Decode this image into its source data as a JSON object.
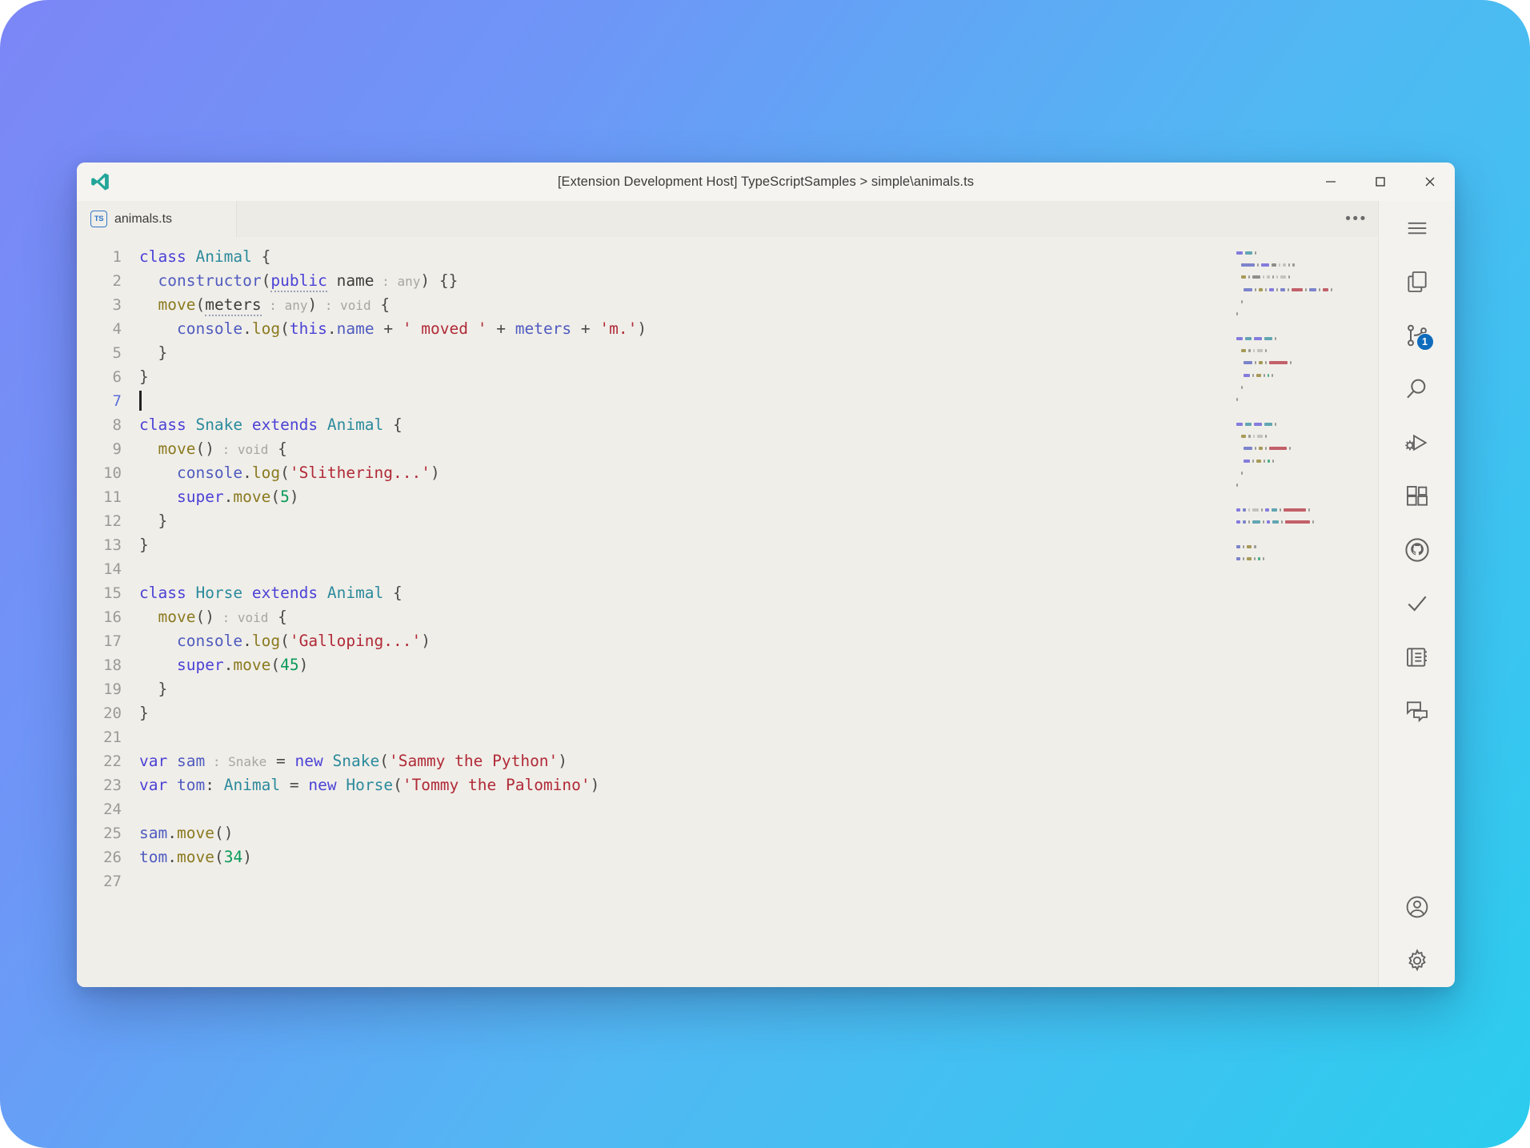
{
  "window": {
    "title": "[Extension Development Host] TypeScriptSamples > simple\\animals.ts",
    "logo_icon": "vscode-logo-icon",
    "controls": {
      "minimize": "minimize-icon",
      "maximize": "maximize-icon",
      "close": "close-icon"
    }
  },
  "tabbar": {
    "tabs": [
      {
        "label": "animals.ts",
        "icon": "typescript-file-icon",
        "badge_text": "TS",
        "active": true
      }
    ],
    "more_actions": "•••"
  },
  "editor": {
    "language": "typescript",
    "cursor_line": 7,
    "background_color": "#f0eee9",
    "total_lines": 27,
    "lines": [
      {
        "n": 1,
        "tokens": [
          {
            "t": "class",
            "c": "t-key"
          },
          {
            "t": " ",
            "c": "t-plain"
          },
          {
            "t": "Animal",
            "c": "t-type"
          },
          {
            "t": " ",
            "c": "t-plain"
          },
          {
            "t": "{",
            "c": "t-punct"
          }
        ]
      },
      {
        "n": 2,
        "tokens": [
          {
            "t": "  ",
            "c": "t-plain"
          },
          {
            "t": "constructor",
            "c": "t-var"
          },
          {
            "t": "(",
            "c": "t-punct"
          },
          {
            "t": "public",
            "c": "t-key",
            "squiggle": true
          },
          {
            "t": " ",
            "c": "t-plain"
          },
          {
            "t": "name",
            "c": "t-plain"
          },
          {
            "t": " : ",
            "c": "t-hint"
          },
          {
            "t": "any",
            "c": "t-hint"
          },
          {
            "t": ")",
            "c": "t-punct"
          },
          {
            "t": " ",
            "c": "t-plain"
          },
          {
            "t": "{}",
            "c": "t-punct"
          }
        ]
      },
      {
        "n": 3,
        "tokens": [
          {
            "t": "  ",
            "c": "t-plain"
          },
          {
            "t": "move",
            "c": "t-fn"
          },
          {
            "t": "(",
            "c": "t-punct"
          },
          {
            "t": "meters",
            "c": "t-plain",
            "squiggle": true
          },
          {
            "t": " : ",
            "c": "t-hint"
          },
          {
            "t": "any",
            "c": "t-hint"
          },
          {
            "t": ")",
            "c": "t-punct"
          },
          {
            "t": " : ",
            "c": "t-hint"
          },
          {
            "t": "void",
            "c": "t-hint"
          },
          {
            "t": " ",
            "c": "t-plain"
          },
          {
            "t": "{",
            "c": "t-punct"
          }
        ]
      },
      {
        "n": 4,
        "tokens": [
          {
            "t": "    ",
            "c": "t-plain"
          },
          {
            "t": "console",
            "c": "t-var"
          },
          {
            "t": ".",
            "c": "t-punct"
          },
          {
            "t": "log",
            "c": "t-fn"
          },
          {
            "t": "(",
            "c": "t-punct"
          },
          {
            "t": "this",
            "c": "t-key"
          },
          {
            "t": ".",
            "c": "t-punct"
          },
          {
            "t": "name",
            "c": "t-var"
          },
          {
            "t": " + ",
            "c": "t-op"
          },
          {
            "t": "' moved '",
            "c": "t-str"
          },
          {
            "t": " + ",
            "c": "t-op"
          },
          {
            "t": "meters",
            "c": "t-var"
          },
          {
            "t": " + ",
            "c": "t-op"
          },
          {
            "t": "'m.'",
            "c": "t-str"
          },
          {
            "t": ")",
            "c": "t-punct"
          }
        ]
      },
      {
        "n": 5,
        "tokens": [
          {
            "t": "  ",
            "c": "t-plain"
          },
          {
            "t": "}",
            "c": "t-punct"
          }
        ]
      },
      {
        "n": 6,
        "tokens": [
          {
            "t": "}",
            "c": "t-punct"
          }
        ]
      },
      {
        "n": 7,
        "tokens": [],
        "cursor": true
      },
      {
        "n": 8,
        "tokens": [
          {
            "t": "class",
            "c": "t-key"
          },
          {
            "t": " ",
            "c": "t-plain"
          },
          {
            "t": "Snake",
            "c": "t-type"
          },
          {
            "t": " ",
            "c": "t-plain"
          },
          {
            "t": "extends",
            "c": "t-key"
          },
          {
            "t": " ",
            "c": "t-plain"
          },
          {
            "t": "Animal",
            "c": "t-type"
          },
          {
            "t": " ",
            "c": "t-plain"
          },
          {
            "t": "{",
            "c": "t-punct"
          }
        ]
      },
      {
        "n": 9,
        "tokens": [
          {
            "t": "  ",
            "c": "t-plain"
          },
          {
            "t": "move",
            "c": "t-fn"
          },
          {
            "t": "()",
            "c": "t-punct"
          },
          {
            "t": " : ",
            "c": "t-hint"
          },
          {
            "t": "void",
            "c": "t-hint"
          },
          {
            "t": " ",
            "c": "t-plain"
          },
          {
            "t": "{",
            "c": "t-punct"
          }
        ]
      },
      {
        "n": 10,
        "tokens": [
          {
            "t": "    ",
            "c": "t-plain"
          },
          {
            "t": "console",
            "c": "t-var"
          },
          {
            "t": ".",
            "c": "t-punct"
          },
          {
            "t": "log",
            "c": "t-fn"
          },
          {
            "t": "(",
            "c": "t-punct"
          },
          {
            "t": "'Slithering...'",
            "c": "t-str"
          },
          {
            "t": ")",
            "c": "t-punct"
          }
        ]
      },
      {
        "n": 11,
        "tokens": [
          {
            "t": "    ",
            "c": "t-plain"
          },
          {
            "t": "super",
            "c": "t-key"
          },
          {
            "t": ".",
            "c": "t-punct"
          },
          {
            "t": "move",
            "c": "t-fn"
          },
          {
            "t": "(",
            "c": "t-punct"
          },
          {
            "t": "5",
            "c": "t-num"
          },
          {
            "t": ")",
            "c": "t-punct"
          }
        ]
      },
      {
        "n": 12,
        "tokens": [
          {
            "t": "  ",
            "c": "t-plain"
          },
          {
            "t": "}",
            "c": "t-punct"
          }
        ]
      },
      {
        "n": 13,
        "tokens": [
          {
            "t": "}",
            "c": "t-punct"
          }
        ]
      },
      {
        "n": 14,
        "tokens": []
      },
      {
        "n": 15,
        "tokens": [
          {
            "t": "class",
            "c": "t-key"
          },
          {
            "t": " ",
            "c": "t-plain"
          },
          {
            "t": "Horse",
            "c": "t-type"
          },
          {
            "t": " ",
            "c": "t-plain"
          },
          {
            "t": "extends",
            "c": "t-key"
          },
          {
            "t": " ",
            "c": "t-plain"
          },
          {
            "t": "Animal",
            "c": "t-type"
          },
          {
            "t": " ",
            "c": "t-plain"
          },
          {
            "t": "{",
            "c": "t-punct"
          }
        ]
      },
      {
        "n": 16,
        "tokens": [
          {
            "t": "  ",
            "c": "t-plain"
          },
          {
            "t": "move",
            "c": "t-fn"
          },
          {
            "t": "()",
            "c": "t-punct"
          },
          {
            "t": " : ",
            "c": "t-hint"
          },
          {
            "t": "void",
            "c": "t-hint"
          },
          {
            "t": " ",
            "c": "t-plain"
          },
          {
            "t": "{",
            "c": "t-punct"
          }
        ]
      },
      {
        "n": 17,
        "tokens": [
          {
            "t": "    ",
            "c": "t-plain"
          },
          {
            "t": "console",
            "c": "t-var"
          },
          {
            "t": ".",
            "c": "t-punct"
          },
          {
            "t": "log",
            "c": "t-fn"
          },
          {
            "t": "(",
            "c": "t-punct"
          },
          {
            "t": "'Galloping...'",
            "c": "t-str"
          },
          {
            "t": ")",
            "c": "t-punct"
          }
        ]
      },
      {
        "n": 18,
        "tokens": [
          {
            "t": "    ",
            "c": "t-plain"
          },
          {
            "t": "super",
            "c": "t-key"
          },
          {
            "t": ".",
            "c": "t-punct"
          },
          {
            "t": "move",
            "c": "t-fn"
          },
          {
            "t": "(",
            "c": "t-punct"
          },
          {
            "t": "45",
            "c": "t-num"
          },
          {
            "t": ")",
            "c": "t-punct"
          }
        ]
      },
      {
        "n": 19,
        "tokens": [
          {
            "t": "  ",
            "c": "t-plain"
          },
          {
            "t": "}",
            "c": "t-punct"
          }
        ]
      },
      {
        "n": 20,
        "tokens": [
          {
            "t": "}",
            "c": "t-punct"
          }
        ]
      },
      {
        "n": 21,
        "tokens": []
      },
      {
        "n": 22,
        "tokens": [
          {
            "t": "var",
            "c": "t-key"
          },
          {
            "t": " ",
            "c": "t-plain"
          },
          {
            "t": "sam",
            "c": "t-var"
          },
          {
            "t": " : ",
            "c": "t-hint"
          },
          {
            "t": "Snake",
            "c": "t-hint"
          },
          {
            "t": " = ",
            "c": "t-op"
          },
          {
            "t": "new",
            "c": "t-key"
          },
          {
            "t": " ",
            "c": "t-plain"
          },
          {
            "t": "Snake",
            "c": "t-type"
          },
          {
            "t": "(",
            "c": "t-punct"
          },
          {
            "t": "'Sammy the Python'",
            "c": "t-str"
          },
          {
            "t": ")",
            "c": "t-punct"
          }
        ]
      },
      {
        "n": 23,
        "tokens": [
          {
            "t": "var",
            "c": "t-key"
          },
          {
            "t": " ",
            "c": "t-plain"
          },
          {
            "t": "tom",
            "c": "t-var"
          },
          {
            "t": ": ",
            "c": "t-punct"
          },
          {
            "t": "Animal",
            "c": "t-type"
          },
          {
            "t": " = ",
            "c": "t-op"
          },
          {
            "t": "new",
            "c": "t-key"
          },
          {
            "t": " ",
            "c": "t-plain"
          },
          {
            "t": "Horse",
            "c": "t-type"
          },
          {
            "t": "(",
            "c": "t-punct"
          },
          {
            "t": "'Tommy the Palomino'",
            "c": "t-str"
          },
          {
            "t": ")",
            "c": "t-punct"
          }
        ]
      },
      {
        "n": 24,
        "tokens": []
      },
      {
        "n": 25,
        "tokens": [
          {
            "t": "sam",
            "c": "t-var"
          },
          {
            "t": ".",
            "c": "t-punct"
          },
          {
            "t": "move",
            "c": "t-fn"
          },
          {
            "t": "()",
            "c": "t-punct"
          }
        ]
      },
      {
        "n": 26,
        "tokens": [
          {
            "t": "tom",
            "c": "t-var"
          },
          {
            "t": ".",
            "c": "t-punct"
          },
          {
            "t": "move",
            "c": "t-fn"
          },
          {
            "t": "(",
            "c": "t-punct"
          },
          {
            "t": "34",
            "c": "t-num"
          },
          {
            "t": ")",
            "c": "t-punct"
          }
        ]
      },
      {
        "n": 27,
        "tokens": []
      }
    ]
  },
  "activitybar": {
    "items": [
      {
        "name": "menu",
        "icon": "hamburger-menu-icon",
        "badge": null
      },
      {
        "name": "explorer",
        "icon": "files-icon",
        "badge": null
      },
      {
        "name": "source-control",
        "icon": "source-control-icon",
        "badge": "1"
      },
      {
        "name": "search",
        "icon": "search-icon",
        "badge": null
      },
      {
        "name": "run-and-debug",
        "icon": "run-and-debug-icon",
        "badge": null
      },
      {
        "name": "extensions",
        "icon": "extensions-icon",
        "badge": null
      },
      {
        "name": "github",
        "icon": "github-icon",
        "badge": null
      },
      {
        "name": "testing",
        "icon": "checkmark-icon",
        "badge": null
      },
      {
        "name": "notebook",
        "icon": "notebook-icon",
        "badge": null
      },
      {
        "name": "chat",
        "icon": "comment-icon",
        "badge": null
      }
    ],
    "bottom_items": [
      {
        "name": "accounts",
        "icon": "account-icon"
      },
      {
        "name": "settings",
        "icon": "gear-icon"
      }
    ]
  },
  "theme": {
    "backdrop_from": "#7c86f6",
    "backdrop_to": "#2bcdee",
    "editor_bg": "#f0eee9",
    "chrome_bg": "#f3f2ee",
    "tabbar_bg": "#edebe6",
    "accent": "#0f6cbd",
    "string_color": "#b02a37",
    "keyword_color": "#4b42d6",
    "type_color": "#2b8a9c",
    "number_color": "#0a9a5a"
  }
}
